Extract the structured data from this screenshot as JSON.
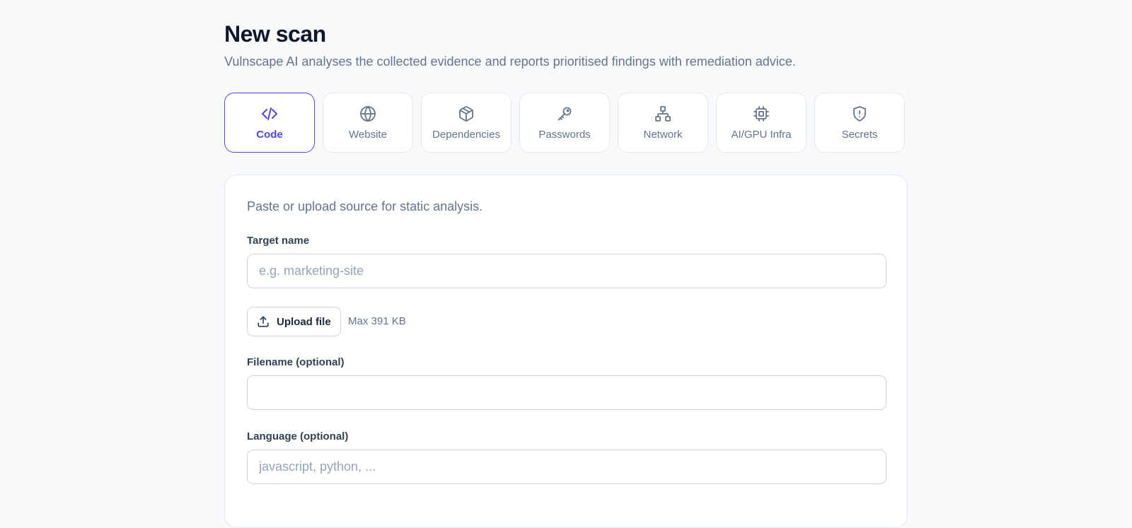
{
  "page": {
    "title": "New scan",
    "subtitle": "Vulnscape AI analyses the collected evidence and reports prioritised findings with remediation advice."
  },
  "tabs": [
    {
      "label": "Code",
      "icon": "code-icon",
      "active": true
    },
    {
      "label": "Website",
      "icon": "globe-icon",
      "active": false
    },
    {
      "label": "Dependencies",
      "icon": "package-icon",
      "active": false
    },
    {
      "label": "Passwords",
      "icon": "key-icon",
      "active": false
    },
    {
      "label": "Network",
      "icon": "network-icon",
      "active": false
    },
    {
      "label": "AI/GPU Infra",
      "icon": "cpu-chip-icon",
      "active": false
    },
    {
      "label": "Secrets",
      "icon": "shield-alert-icon",
      "active": false
    }
  ],
  "form": {
    "description": "Paste or upload source for static analysis.",
    "target_name": {
      "label": "Target name",
      "value": "",
      "placeholder": "e.g. marketing-site"
    },
    "upload": {
      "label": "Upload file",
      "icon": "upload-icon",
      "max_size": "Max 391 KB"
    },
    "filename": {
      "label": "Filename (optional)",
      "value": "",
      "placeholder": ""
    },
    "language": {
      "label": "Language (optional)",
      "value": "",
      "placeholder": "javascript, python, ..."
    }
  },
  "colors": {
    "accent": "#4f46e5",
    "background": "#f8f9fb",
    "muted_text": "#64748b",
    "border": "#e2e8f0"
  }
}
